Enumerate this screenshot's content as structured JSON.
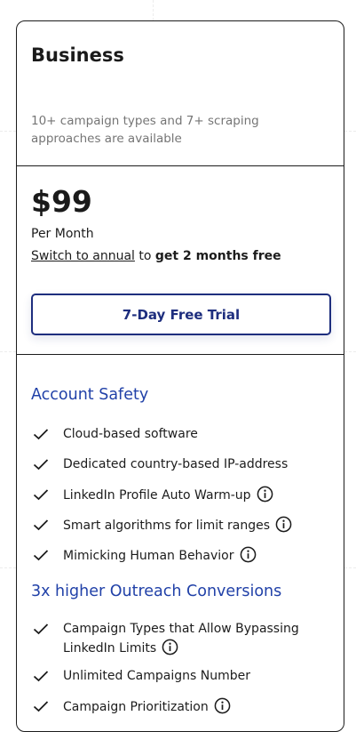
{
  "plan": {
    "title": "Business",
    "description": "10+ campaign types and 7+ scraping approaches are available"
  },
  "pricing": {
    "price": "$99",
    "period": "Per Month",
    "switch_link": "Switch to annual",
    "switch_mid": " to ",
    "switch_bonus": "get 2 months free",
    "trial_button": "7-Day Free Trial"
  },
  "sections": [
    {
      "title": "Account Safety",
      "features": [
        {
          "text": "Cloud-based software"
        },
        {
          "text": "Dedicated country-based IP-address"
        },
        {
          "text": "LinkedIn Profile Auto Warm-up"
        },
        {
          "text": "Smart algorithms for limit ranges"
        },
        {
          "text": "Mimicking Human Behavior"
        }
      ]
    },
    {
      "title": "3x higher Outreach Conversions",
      "features": [
        {
          "text": "Campaign Types that Allow Bypassing LinkedIn Limits"
        },
        {
          "text": "Unlimited Campaigns Number"
        },
        {
          "text": "Campaign Prioritization"
        }
      ]
    }
  ],
  "colors": {
    "accent": "#1e2e7e",
    "section_title": "#2141a8",
    "border": "#1c1c1c"
  },
  "icons": {
    "check": "check-icon",
    "info": "info-icon"
  }
}
